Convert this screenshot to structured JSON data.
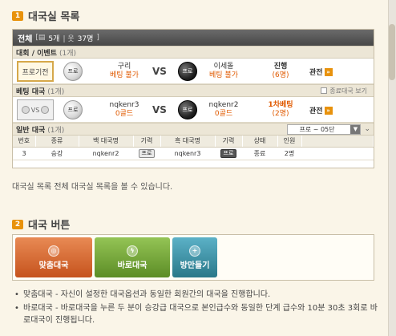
{
  "section1": {
    "number": "1",
    "title": "대국실 목록"
  },
  "panel": {
    "header_title": "전체",
    "header_rooms": "5개",
    "header_people": "37명",
    "tournament": {
      "label": "대회 / 이벤트",
      "count": "(1개)",
      "pro_label": "프로기전",
      "white_stone": "프로",
      "black_stone": "프로",
      "left_player": "구리",
      "left_bet": "베팅 불가",
      "vs": "VS",
      "right_player": "이세돌",
      "right_bet": "베팅 불가",
      "status": "진행",
      "status_sub": "(6명)",
      "watch": "관전"
    },
    "betting": {
      "label": "베팅 대국",
      "count": "(1개)",
      "show_ended": "종료대국 보기",
      "medal_vs": "VS",
      "white_stone": "프로",
      "black_stone": "프로",
      "left_player": "nqkenr3",
      "left_gold": "0골드",
      "vs": "VS",
      "right_player": "nqkenr2",
      "right_gold": "0골드",
      "status": "1차베팅",
      "status_sub": "(2명)",
      "watch": "관전"
    },
    "general": {
      "label": "일반 대국",
      "count": "(1개)",
      "filter_value": "프로 ~ 05단",
      "columns": [
        "번호",
        "종류",
        "백 대국명",
        "기력",
        "흑 대국명",
        "기력",
        "상태",
        "인원"
      ],
      "rows": [
        {
          "no": "3",
          "type": "승강",
          "white_name": "nqkenr2",
          "white_rank": "프로",
          "black_name": "nqkenr3",
          "black_rank": "프로",
          "state": "종료",
          "people": "2명"
        }
      ]
    }
  },
  "description": "대국실 목록 전체 대국실 목록을 볼 수 있습니다.",
  "section2": {
    "number": "2",
    "title": "대국 버튼"
  },
  "buttons": {
    "quick": "맞춤대국",
    "direct": "바로대국",
    "room": "방만들기"
  },
  "bullets": [
    "맞춤대국 - 자신이 설정한 대국옵션과 동일한 회원간의 대국을 진행합니다.",
    "바로대국 - 바로대국을 누른 두 분이 승강급 대국으로 본인급수와 동일한 단계 급수와 10분 30초 3회로 바로대국이 진행됩니다."
  ],
  "colors": {
    "accent": "#e8920c",
    "status_orange": "#e05a00",
    "quick_btn": "#d8703a",
    "direct_btn": "#7aab3c",
    "room_btn": "#3e95aa"
  },
  "icons": [
    "arrow-right-icon",
    "checkbox-icon",
    "dropdown-icon",
    "double-chevron-icon",
    "medal-icon"
  ]
}
